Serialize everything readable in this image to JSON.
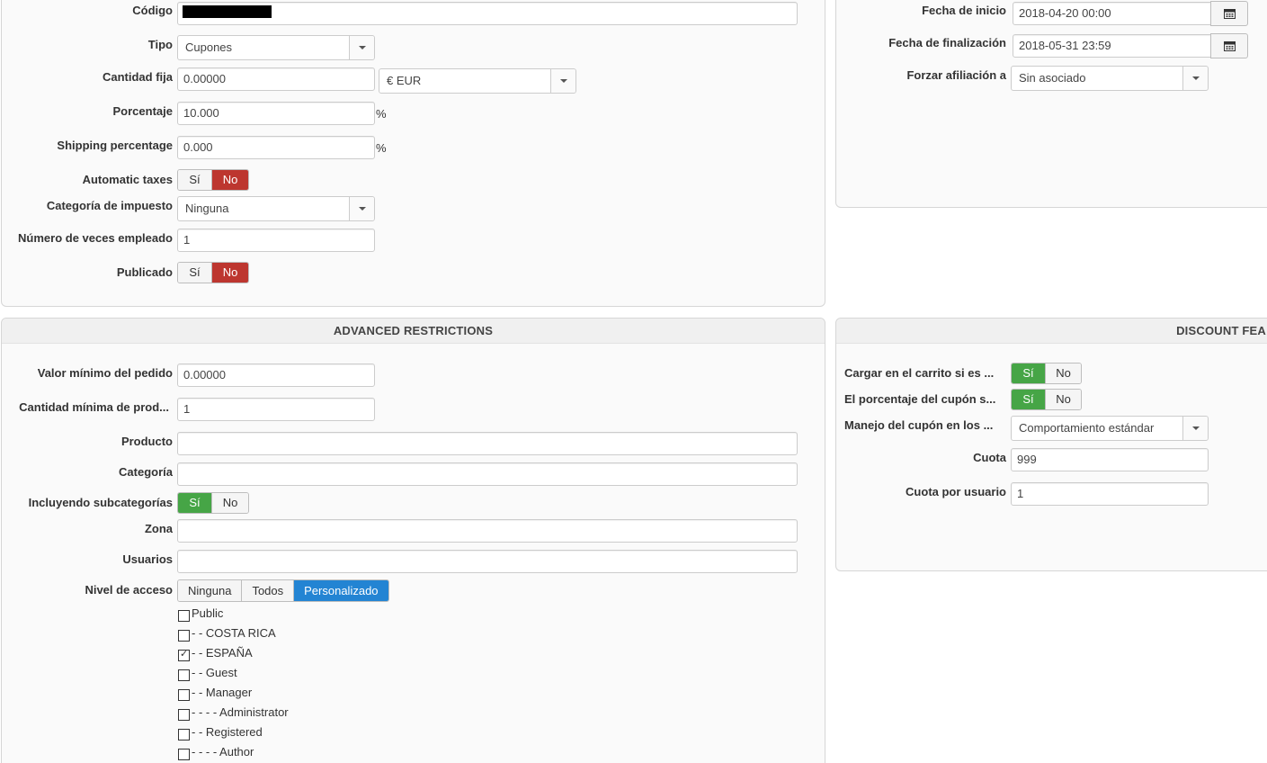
{
  "general": {
    "codigo_label": "Código",
    "tipo_label": "Tipo",
    "tipo_value": "Cupones",
    "cantidad_fija_label": "Cantidad fija",
    "cantidad_fija_value": "0.00000",
    "currency_value": "€ EUR",
    "porcentaje_label": "Porcentaje",
    "porcentaje_value": "10.000",
    "percent_sign": "%",
    "shipping_label": "Shipping percentage",
    "shipping_value": "0.000",
    "auto_taxes_label": "Automatic taxes",
    "yes": "Sí",
    "no": "No",
    "categoria_impuesto_label": "Categoría de impuesto",
    "categoria_impuesto_value": "Ninguna",
    "veces_label": "Número de veces empleado",
    "veces_value": "1",
    "publicado_label": "Publicado"
  },
  "dates": {
    "inicio_label": "Fecha de inicio",
    "inicio_value": "2018-04-20 00:00",
    "fin_label": "Fecha de finalización",
    "fin_value": "2018-05-31 23:59",
    "afiliacion_label": "Forzar afiliación a",
    "afiliacion_value": "Sin asociado"
  },
  "advanced": {
    "title": "ADVANCED RESTRICTIONS",
    "valor_min_label": "Valor mínimo del pedido",
    "valor_min_value": "0.00000",
    "cantidad_min_label": "Cantidad mínima de prod...",
    "cantidad_min_value": "1",
    "producto_label": "Producto",
    "categoria_label": "Categoría",
    "subcat_label": "Incluyendo subcategorías",
    "zona_label": "Zona",
    "usuarios_label": "Usuarios",
    "nivel_label": "Nivel de acceso",
    "nivel_options": [
      "Ninguna",
      "Todos",
      "Personalizado"
    ],
    "access_groups": [
      {
        "label": "Public",
        "checked": false
      },
      {
        "label": "- - COSTA RICA",
        "checked": false
      },
      {
        "label": "- - ESPAÑA",
        "checked": true
      },
      {
        "label": "- - Guest",
        "checked": false
      },
      {
        "label": "- - Manager",
        "checked": false
      },
      {
        "label": "- - - - Administrator",
        "checked": false
      },
      {
        "label": "- - Registered",
        "checked": false
      },
      {
        "label": "- - - - Author",
        "checked": false
      }
    ]
  },
  "discount": {
    "title": "DISCOUNT FEA",
    "carrito_label": "Cargar en el carrito si es ...",
    "porcentaje_cupon_label": "El porcentaje del cupón s...",
    "manejo_label": "Manejo del cupón en los ...",
    "manejo_value": "Comportamiento estándar",
    "cuota_label": "Cuota",
    "cuota_value": "999",
    "cuota_usuario_label": "Cuota por usuario",
    "cuota_usuario_value": "1"
  },
  "colors": {
    "toggle_no_active": "#bd362f",
    "toggle_yes_active": "#46a546",
    "button_active": "#2384d3"
  }
}
